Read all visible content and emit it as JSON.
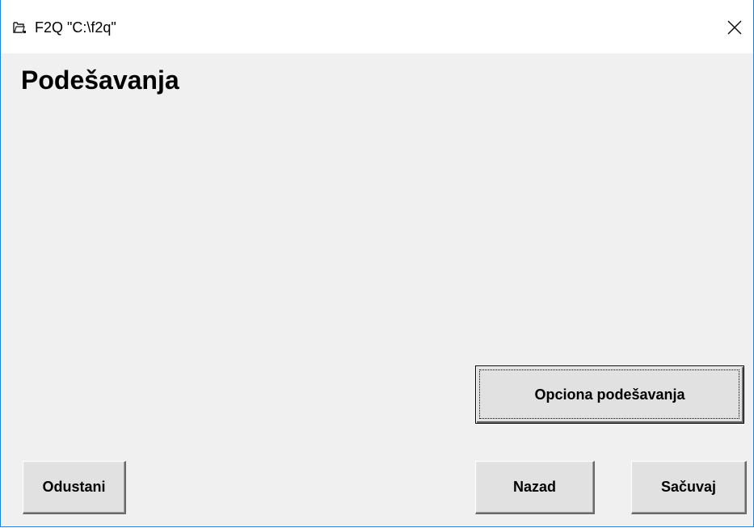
{
  "window": {
    "title": "F2Q \"C:\\f2q\"",
    "icon": "app-window-icon",
    "close_icon": "close-icon"
  },
  "page": {
    "title": "Podešavanja"
  },
  "buttons": {
    "optional_settings": "Opciona podešavanja",
    "cancel": "Odustani",
    "back": "Nazad",
    "save": "Sačuvaj"
  },
  "colors": {
    "window_border": "#1883d7",
    "client_background": "#f0f0f0",
    "button_face": "#e1e1e1"
  }
}
